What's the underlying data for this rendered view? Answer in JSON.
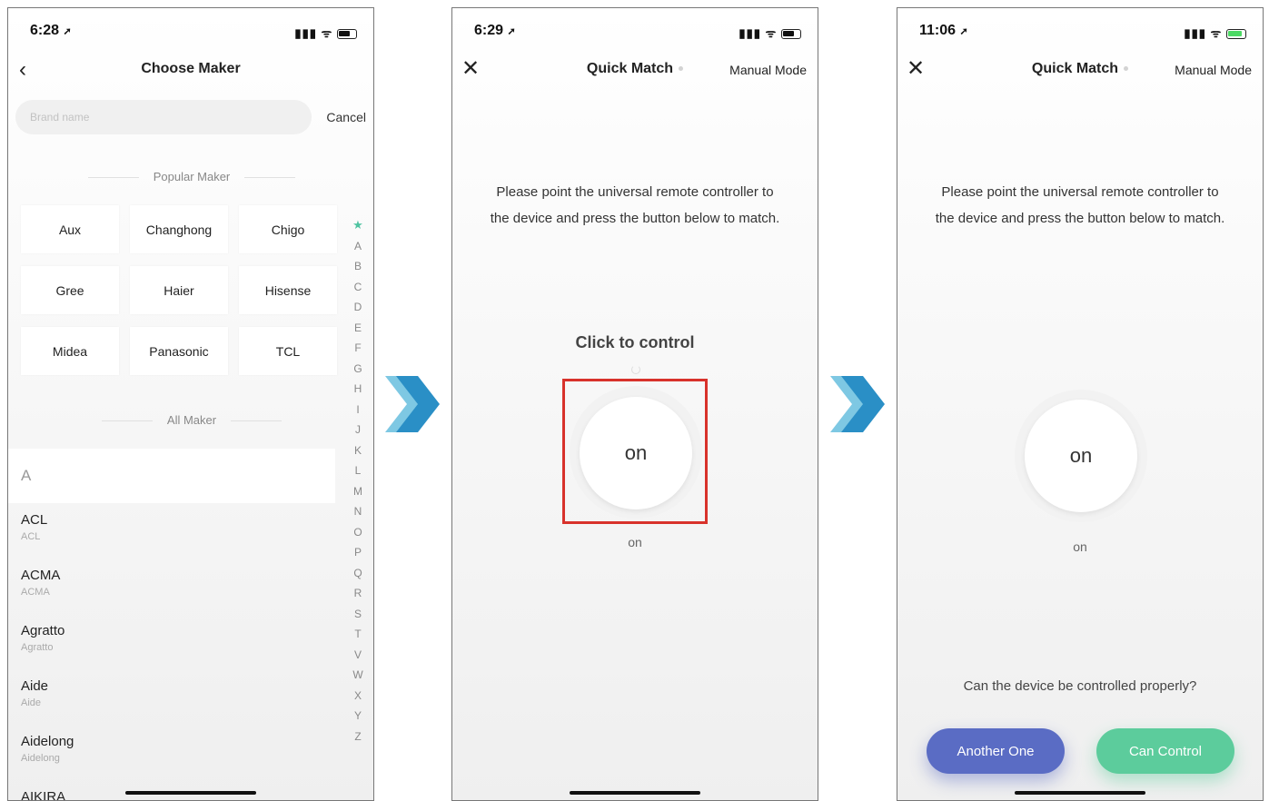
{
  "screens": [
    {
      "status": {
        "time": "6:28",
        "signal": "▮▮▮ ᯤ"
      },
      "header": {
        "title": "Choose Maker"
      },
      "search": {
        "placeholder": "Brand name",
        "cancel": "Cancel"
      },
      "popular_label": "Popular Maker",
      "popular": [
        "Aux",
        "Changhong",
        "Chigo",
        "Gree",
        "Haier",
        "Hisense",
        "Midea",
        "Panasonic",
        "TCL"
      ],
      "all_label": "All Maker",
      "index_letters": [
        "★",
        "A",
        "B",
        "C",
        "D",
        "E",
        "F",
        "G",
        "H",
        "I",
        "J",
        "K",
        "L",
        "M",
        "N",
        "O",
        "P",
        "Q",
        "R",
        "S",
        "T",
        "V",
        "W",
        "X",
        "Y",
        "Z"
      ],
      "section_letter": "A",
      "list": [
        {
          "name": "ACL",
          "sub": "ACL"
        },
        {
          "name": "ACMA",
          "sub": "ACMA"
        },
        {
          "name": "Agratto",
          "sub": "Agratto"
        },
        {
          "name": "Aide",
          "sub": "Aide"
        },
        {
          "name": "Aidelong",
          "sub": "Aidelong"
        },
        {
          "name": "AIKIRA",
          "sub": ""
        }
      ]
    },
    {
      "status": {
        "time": "6:29",
        "signal": "▮▮▮ ᯤ"
      },
      "header": {
        "title": "Quick Match",
        "manual": "Manual Mode"
      },
      "instruction": "Please point the universal remote controller to the device and press the button below to match.",
      "click_to_control": "Click to control",
      "button_label": "on",
      "caption": "on"
    },
    {
      "status": {
        "time": "11:06",
        "signal": "▮▮▮ ᯤ"
      },
      "header": {
        "title": "Quick Match",
        "manual": "Manual Mode"
      },
      "instruction": "Please point the universal remote controller to the device and press the button below to match.",
      "button_label": "on",
      "caption": "on",
      "question": "Can the device be controlled properly?",
      "another": "Another One",
      "can_control": "Can Control"
    }
  ],
  "colors": {
    "highlight": "#d8322b",
    "another_button": "#5a6cc4",
    "can_control_button": "#5ccc9c",
    "arrow": "#2a8fc6"
  },
  "icons": {
    "location": "location-arrow-icon",
    "back": "chevron-left-icon",
    "close": "close-icon",
    "arrow": "chevron-right-arrow-icon"
  }
}
